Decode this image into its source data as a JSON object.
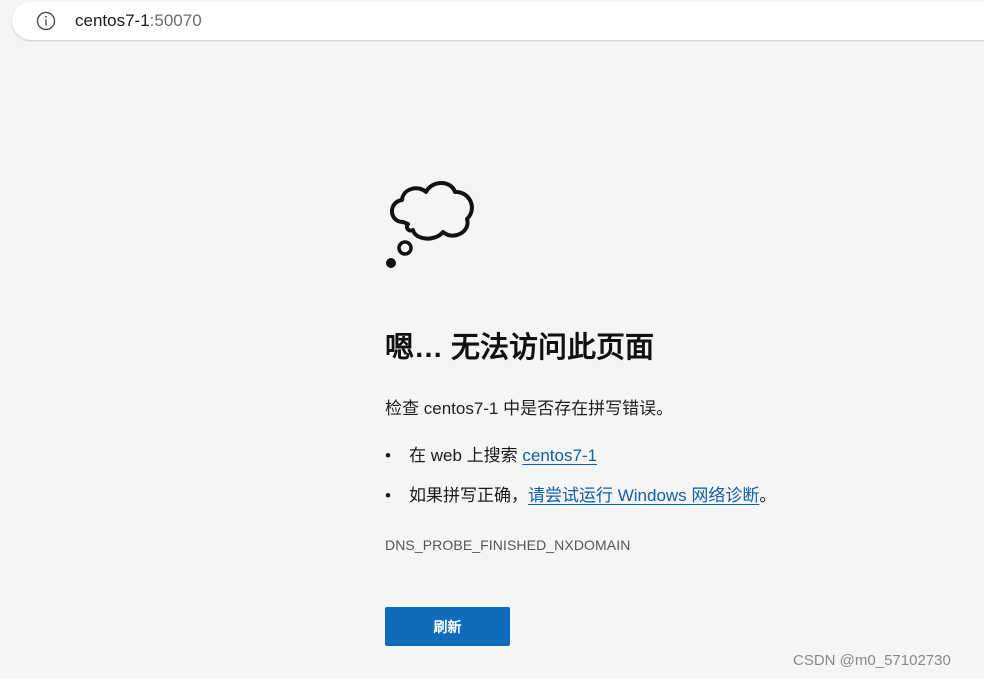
{
  "browser": {
    "url_host": "centos7-1",
    "url_port": ":50070"
  },
  "error_page": {
    "title": "嗯… 无法访问此页面",
    "check_prefix": "检查 ",
    "check_host": "centos7-1",
    "check_suffix": " 中是否存在拼写错误。",
    "bullets": [
      {
        "prefix": "在 web 上搜索 ",
        "link": "centos7-1",
        "suffix": ""
      },
      {
        "prefix": "如果拼写正确，",
        "link": "请尝试运行 Windows 网络诊断",
        "suffix": "。"
      }
    ],
    "bullet_char": "•",
    "error_code": "DNS_PROBE_FINISHED_NXDOMAIN",
    "refresh_label": "刷新"
  },
  "watermark": "CSDN @m0_57102730",
  "colors": {
    "background": "#f5f5f5",
    "link": "#0f5fa6",
    "button": "#0f6cbd"
  }
}
